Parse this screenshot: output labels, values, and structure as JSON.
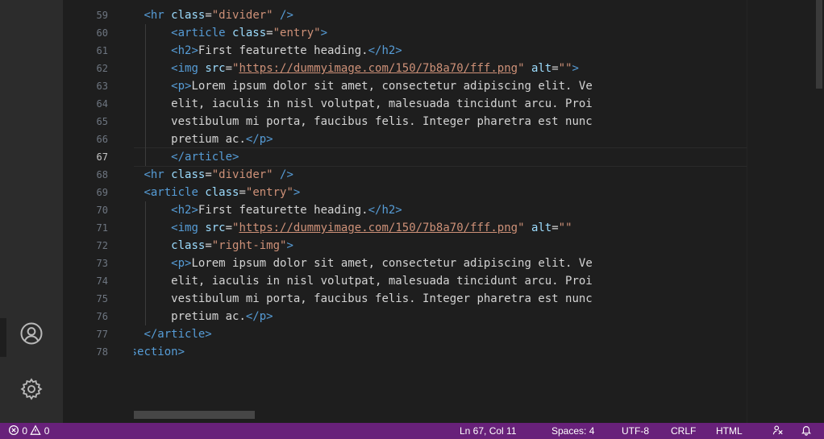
{
  "activity_bar": {
    "icons": [
      {
        "name": "account-icon"
      },
      {
        "name": "settings-gear-icon"
      }
    ]
  },
  "editor": {
    "current_line": 67,
    "lines": [
      {
        "num": "59",
        "indent": 2,
        "tokens": [
          [
            "tag",
            "<hr "
          ],
          [
            "attr",
            "class"
          ],
          [
            "eq",
            "="
          ],
          [
            "str",
            "\"divider\""
          ],
          [
            "tag",
            " />"
          ]
        ]
      },
      {
        "num": "60",
        "indent": 3,
        "tokens": [
          [
            "tag",
            "<article "
          ],
          [
            "attr",
            "class"
          ],
          [
            "eq",
            "="
          ],
          [
            "str",
            "\"entry\""
          ],
          [
            "tag",
            ">"
          ]
        ]
      },
      {
        "num": "61",
        "indent": 3,
        "tokens": [
          [
            "tag",
            "<h2>"
          ],
          [
            "text",
            "First featurette heading."
          ],
          [
            "tag",
            "</h2>"
          ]
        ]
      },
      {
        "num": "62",
        "indent": 3,
        "tokens": [
          [
            "tag",
            "<img "
          ],
          [
            "attr",
            "src"
          ],
          [
            "eq",
            "="
          ],
          [
            "str",
            "\""
          ],
          [
            "url",
            "https://dummyimage.com/150/7b8a70/fff.png"
          ],
          [
            "str",
            "\""
          ],
          [
            "text",
            " "
          ],
          [
            "attr",
            "alt"
          ],
          [
            "eq",
            "="
          ],
          [
            "str",
            "\"\""
          ],
          [
            "tag",
            ">"
          ]
        ]
      },
      {
        "num": "63",
        "indent": 3,
        "tokens": [
          [
            "tag",
            "<p>"
          ],
          [
            "text",
            "Lorem ipsum dolor sit amet, consectetur adipiscing elit. Ve"
          ]
        ]
      },
      {
        "num": "64",
        "indent": 3,
        "tokens": [
          [
            "text",
            "elit, iaculis in nisl volutpat, malesuada tincidunt arcu. Proi"
          ]
        ]
      },
      {
        "num": "65",
        "indent": 3,
        "tokens": [
          [
            "text",
            "vestibulum mi porta, faucibus felis. Integer pharetra est nunc"
          ]
        ]
      },
      {
        "num": "66",
        "indent": 3,
        "tokens": [
          [
            "text",
            "pretium ac."
          ],
          [
            "tag",
            "</p>"
          ]
        ]
      },
      {
        "num": "67",
        "indent": 3,
        "tokens": [
          [
            "tag",
            "</article>"
          ]
        ]
      },
      {
        "num": "68",
        "indent": 2,
        "tokens": [
          [
            "tag",
            "<hr "
          ],
          [
            "attr",
            "class"
          ],
          [
            "eq",
            "="
          ],
          [
            "str",
            "\"divider\""
          ],
          [
            "tag",
            " />"
          ]
        ]
      },
      {
        "num": "69",
        "indent": 2,
        "tokens": [
          [
            "tag",
            "<article "
          ],
          [
            "attr",
            "class"
          ],
          [
            "eq",
            "="
          ],
          [
            "str",
            "\"entry\""
          ],
          [
            "tag",
            ">"
          ]
        ]
      },
      {
        "num": "70",
        "indent": 3,
        "tokens": [
          [
            "tag",
            "<h2>"
          ],
          [
            "text",
            "First featurette heading."
          ],
          [
            "tag",
            "</h2>"
          ]
        ]
      },
      {
        "num": "71",
        "indent": 3,
        "tokens": [
          [
            "tag",
            "<img "
          ],
          [
            "attr",
            "src"
          ],
          [
            "eq",
            "="
          ],
          [
            "str",
            "\""
          ],
          [
            "url",
            "https://dummyimage.com/150/7b8a70/fff.png"
          ],
          [
            "str",
            "\""
          ],
          [
            "text",
            " "
          ],
          [
            "attr",
            "alt"
          ],
          [
            "eq",
            "="
          ],
          [
            "str",
            "\"\""
          ]
        ]
      },
      {
        "num": "72",
        "indent": 3,
        "tokens": [
          [
            "attr",
            "class"
          ],
          [
            "eq",
            "="
          ],
          [
            "str",
            "\"right-img\""
          ],
          [
            "tag",
            ">"
          ]
        ]
      },
      {
        "num": "73",
        "indent": 3,
        "tokens": [
          [
            "tag",
            "<p>"
          ],
          [
            "text",
            "Lorem ipsum dolor sit amet, consectetur adipiscing elit. Ve"
          ]
        ]
      },
      {
        "num": "74",
        "indent": 3,
        "tokens": [
          [
            "text",
            "elit, iaculis in nisl volutpat, malesuada tincidunt arcu. Proi"
          ]
        ]
      },
      {
        "num": "75",
        "indent": 3,
        "tokens": [
          [
            "text",
            "vestibulum mi porta, faucibus felis. Integer pharetra est nunc"
          ]
        ]
      },
      {
        "num": "76",
        "indent": 3,
        "tokens": [
          [
            "text",
            "pretium ac."
          ],
          [
            "tag",
            "</p>"
          ]
        ]
      },
      {
        "num": "77",
        "indent": 2,
        "tokens": [
          [
            "tag",
            "</article>"
          ]
        ]
      },
      {
        "num": "78",
        "indent": 1,
        "tokens": [
          [
            "tag",
            "</section>"
          ]
        ]
      }
    ]
  },
  "statusbar": {
    "errors": "0",
    "warnings": "0",
    "cursor_position": "Ln 67, Col 11",
    "indentation": "Spaces: 4",
    "encoding": "UTF-8",
    "line_ending": "CRLF",
    "language": "HTML"
  },
  "colors": {
    "statusbar": "#68217a",
    "editor_bg": "#1e1e1e",
    "tag": "#569cd6",
    "attribute": "#9cdcfe",
    "string": "#ce9178"
  }
}
